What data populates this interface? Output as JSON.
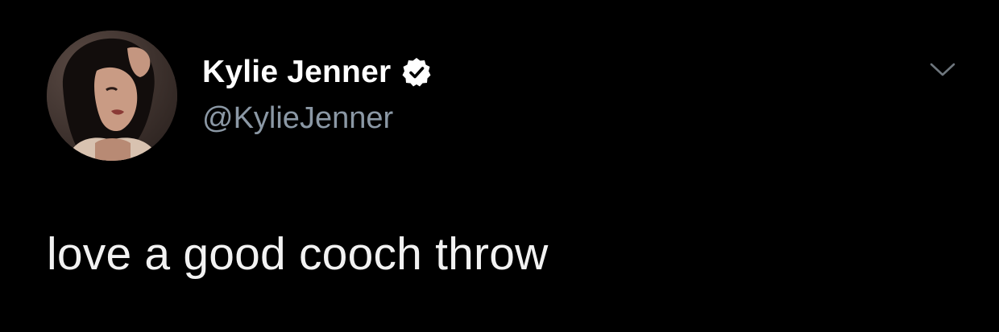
{
  "tweet": {
    "author": {
      "display_name": "Kylie Jenner",
      "handle": "@KylieJenner",
      "verified": true,
      "avatar_icon": "profile-photo",
      "verified_icon": "verified-badge-icon"
    },
    "menu_icon": "chevron-down-icon",
    "text": "love a good cooch throw"
  },
  "colors": {
    "background": "#000000",
    "name": "#ffffff",
    "handle": "#8b98a5",
    "text": "#f2f2f2",
    "chevron": "#6e767d",
    "verified_badge": "#ffffff"
  }
}
